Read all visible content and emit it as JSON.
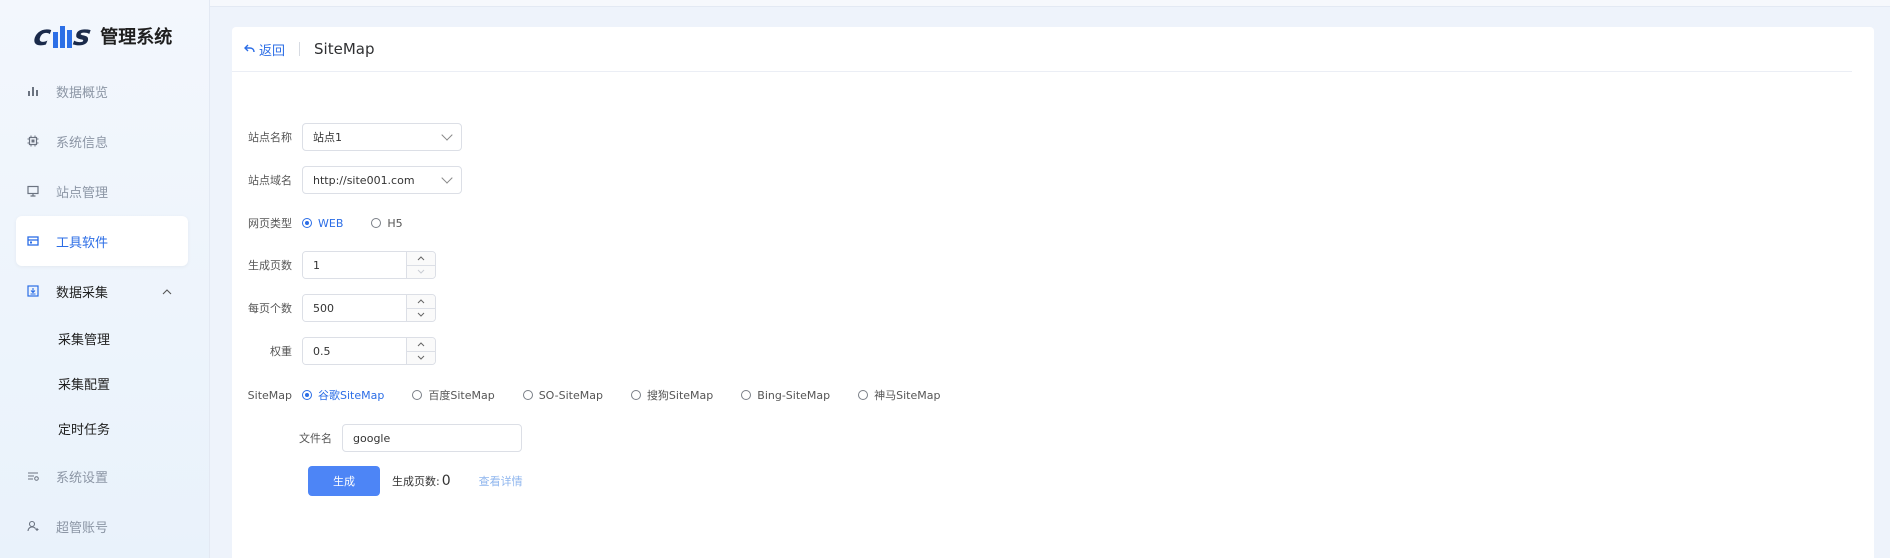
{
  "app": {
    "logo_text": "管理系统"
  },
  "sidebar": {
    "items": [
      {
        "label": "数据概览",
        "icon": "bar-chart-icon"
      },
      {
        "label": "系统信息",
        "icon": "chip-icon"
      },
      {
        "label": "站点管理",
        "icon": "monitor-icon"
      },
      {
        "label": "工具软件",
        "icon": "toolbox-icon",
        "active": true
      },
      {
        "label": "数据采集",
        "icon": "download-box-icon",
        "expanded": true
      }
    ],
    "sub_items": [
      {
        "label": "采集管理"
      },
      {
        "label": "采集配置"
      },
      {
        "label": "定时任务"
      }
    ],
    "bottom_items": [
      {
        "label": "系统设置",
        "icon": "settings-sliders-icon"
      },
      {
        "label": "超管账号",
        "icon": "user-icon"
      }
    ]
  },
  "header": {
    "back_label": "返回",
    "title": "SiteMap"
  },
  "form": {
    "site_name": {
      "label": "站点名称",
      "value": "站点1"
    },
    "site_domain": {
      "label": "站点域名",
      "value": "http://site001.com"
    },
    "page_type": {
      "label": "网页类型",
      "options": [
        "WEB",
        "H5"
      ],
      "selected": "WEB"
    },
    "gen_pages": {
      "label": "生成页数",
      "value": "1"
    },
    "per_page": {
      "label": "每页个数",
      "value": "500"
    },
    "weight": {
      "label": "权重",
      "value": "0.5"
    },
    "sitemap": {
      "label": "SiteMap",
      "options": [
        "谷歌SiteMap",
        "百度SiteMap",
        "SO-SiteMap",
        "搜狗SiteMap",
        "Bing-SiteMap",
        "神马SiteMap"
      ],
      "selected": "谷歌SiteMap"
    },
    "filename": {
      "label": "文件名",
      "value": "google"
    },
    "generate_button": "生成",
    "generated_count_label": "生成页数:",
    "generated_count": "0",
    "view_detail": "查看详情"
  },
  "colors": {
    "accent": "#2b6de6",
    "button": "#4d85f6"
  }
}
